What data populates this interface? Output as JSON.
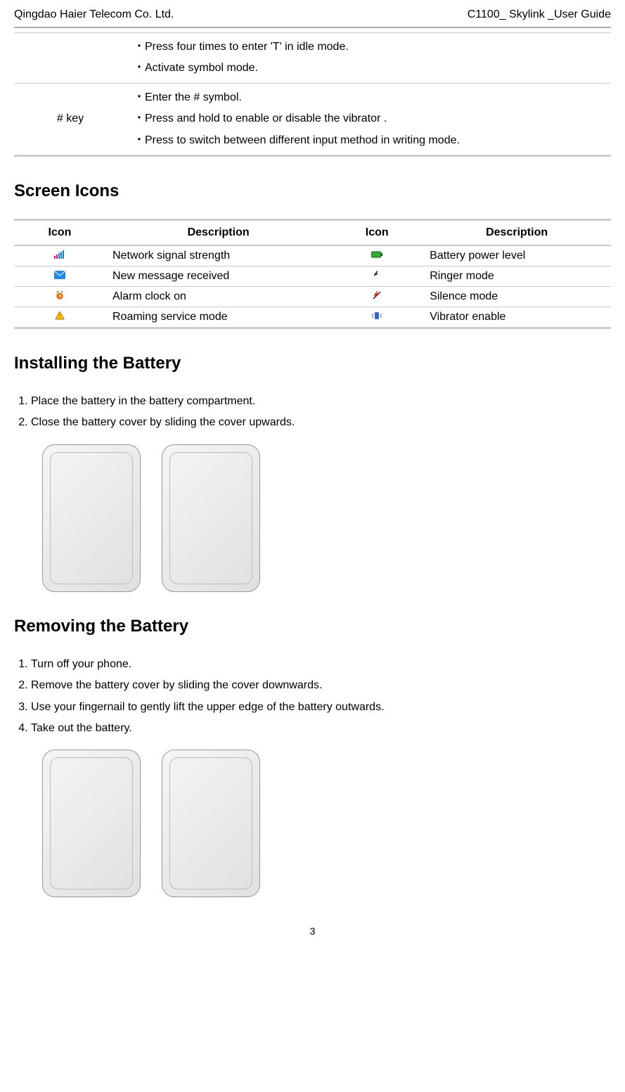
{
  "header": {
    "left": "Qingdao Haier Telecom Co. Ltd.",
    "right": "C1100_ Skylink _User Guide"
  },
  "key_table": {
    "row1": {
      "key": "",
      "lines": [
        "・Press four    times to enter 'T' in idle mode.",
        "・Activate symbol mode."
      ]
    },
    "row2": {
      "key": "# key",
      "lines": [
        "・Enter the # symbol.",
        "・Press and hold to enable or disable the vibrator .",
        "・Press to switch between different input method in writing mode."
      ]
    }
  },
  "sections": {
    "screen_icons": "Screen Icons",
    "installing_battery": "Installing the Battery",
    "removing_battery": "Removing the Battery"
  },
  "icon_table": {
    "headers": [
      "Icon",
      "Description",
      "Icon",
      "Description"
    ],
    "rows": [
      {
        "icon1": "signal-icon",
        "desc1": "Network signal strength",
        "icon2": "battery-icon",
        "desc2": "Battery power level"
      },
      {
        "icon1": "message-icon",
        "desc1": "New message received",
        "icon2": "ringer-icon",
        "desc2": "Ringer mode"
      },
      {
        "icon1": "alarm-icon",
        "desc1": "Alarm clock on",
        "icon2": "silence-icon",
        "desc2": "Silence mode"
      },
      {
        "icon1": "roaming-icon",
        "desc1": "Roaming service mode",
        "icon2": "vibrator-icon",
        "desc2": "Vibrator enable"
      }
    ]
  },
  "installing_steps": [
    "Place the battery in the battery compartment.",
    "Close the battery cover by sliding the cover upwards."
  ],
  "removing_steps": [
    "Turn off your phone.",
    "Remove the battery cover by sliding the cover downwards.",
    "Use your fingernail to gently lift the upper edge of the battery outwards.",
    "Take out the battery."
  ],
  "page_number": "3"
}
